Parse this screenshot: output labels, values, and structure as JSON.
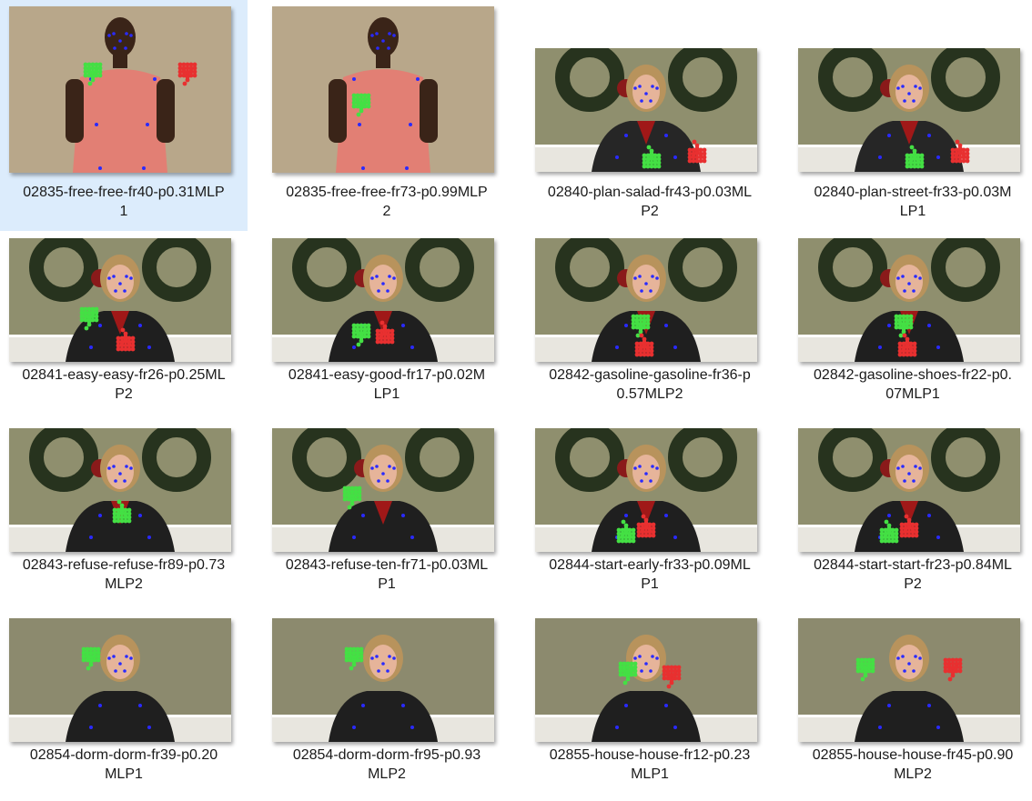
{
  "files": [
    {
      "line1": "02835-free-free-fr40-p0.31MLP",
      "line2": "1",
      "scene": "man",
      "selected": true,
      "pose": "both-up"
    },
    {
      "line1": "02835-free-free-fr73-p0.99MLP",
      "line2": "2",
      "scene": "man",
      "selected": false,
      "pose": "left-mid"
    },
    {
      "line1": "02840-plan-salad-fr43-p0.03ML",
      "line2": "P2",
      "scene": "woman-wreath",
      "selected": false,
      "pose": "low-both"
    },
    {
      "line1": "02840-plan-street-fr33-p0.03M",
      "line2": "LP1",
      "scene": "woman-wreath",
      "selected": false,
      "pose": "low-both"
    },
    {
      "line1": "02841-easy-easy-fr26-p0.25ML",
      "line2": "P2",
      "scene": "woman-wreath-dark",
      "selected": false,
      "pose": "spread"
    },
    {
      "line1": "02841-easy-good-fr17-p0.02M",
      "line2": "LP1",
      "scene": "woman-wreath-dark",
      "selected": false,
      "pose": "center"
    },
    {
      "line1": "02842-gasoline-gasoline-fr36-p",
      "line2": "0.57MLP2",
      "scene": "woman-wreath-dark",
      "selected": false,
      "pose": "stacked"
    },
    {
      "line1": "02842-gasoline-shoes-fr22-p0.",
      "line2": "07MLP1",
      "scene": "woman-wreath-dark",
      "selected": false,
      "pose": "stacked"
    },
    {
      "line1": "02843-refuse-refuse-fr89-p0.73",
      "line2": "MLP2",
      "scene": "woman-wreath-dark",
      "selected": false,
      "pose": "single-green"
    },
    {
      "line1": "02843-refuse-ten-fr71-p0.03ML",
      "line2": "P1",
      "scene": "woman-wreath-dark",
      "selected": false,
      "pose": "thumb-up"
    },
    {
      "line1": "02844-start-early-fr33-p0.09ML",
      "line2": "P1",
      "scene": "woman-wreath-dark",
      "selected": false,
      "pose": "together"
    },
    {
      "line1": "02844-start-start-fr23-p0.84ML",
      "line2": "P2",
      "scene": "woman-wreath-dark",
      "selected": false,
      "pose": "together"
    },
    {
      "line1": "02854-dorm-dorm-fr39-p0.20",
      "line2": "MLP1",
      "scene": "woman-plain",
      "selected": false,
      "pose": "finger-up"
    },
    {
      "line1": "02854-dorm-dorm-fr95-p0.93",
      "line2": "MLP2",
      "scene": "woman-plain",
      "selected": false,
      "pose": "finger-up"
    },
    {
      "line1": "02855-house-house-fr12-p0.23",
      "line2": "MLP1",
      "scene": "woman-plain",
      "selected": false,
      "pose": "roof"
    },
    {
      "line1": "02855-house-house-fr45-p0.90",
      "line2": "MLP2",
      "scene": "woman-plain",
      "selected": false,
      "pose": "hands-up"
    }
  ],
  "colors": {
    "left_hand": "#44e044",
    "right_hand": "#e83030",
    "pose_points": "#2a2aff",
    "selection": "#dcecfc"
  }
}
